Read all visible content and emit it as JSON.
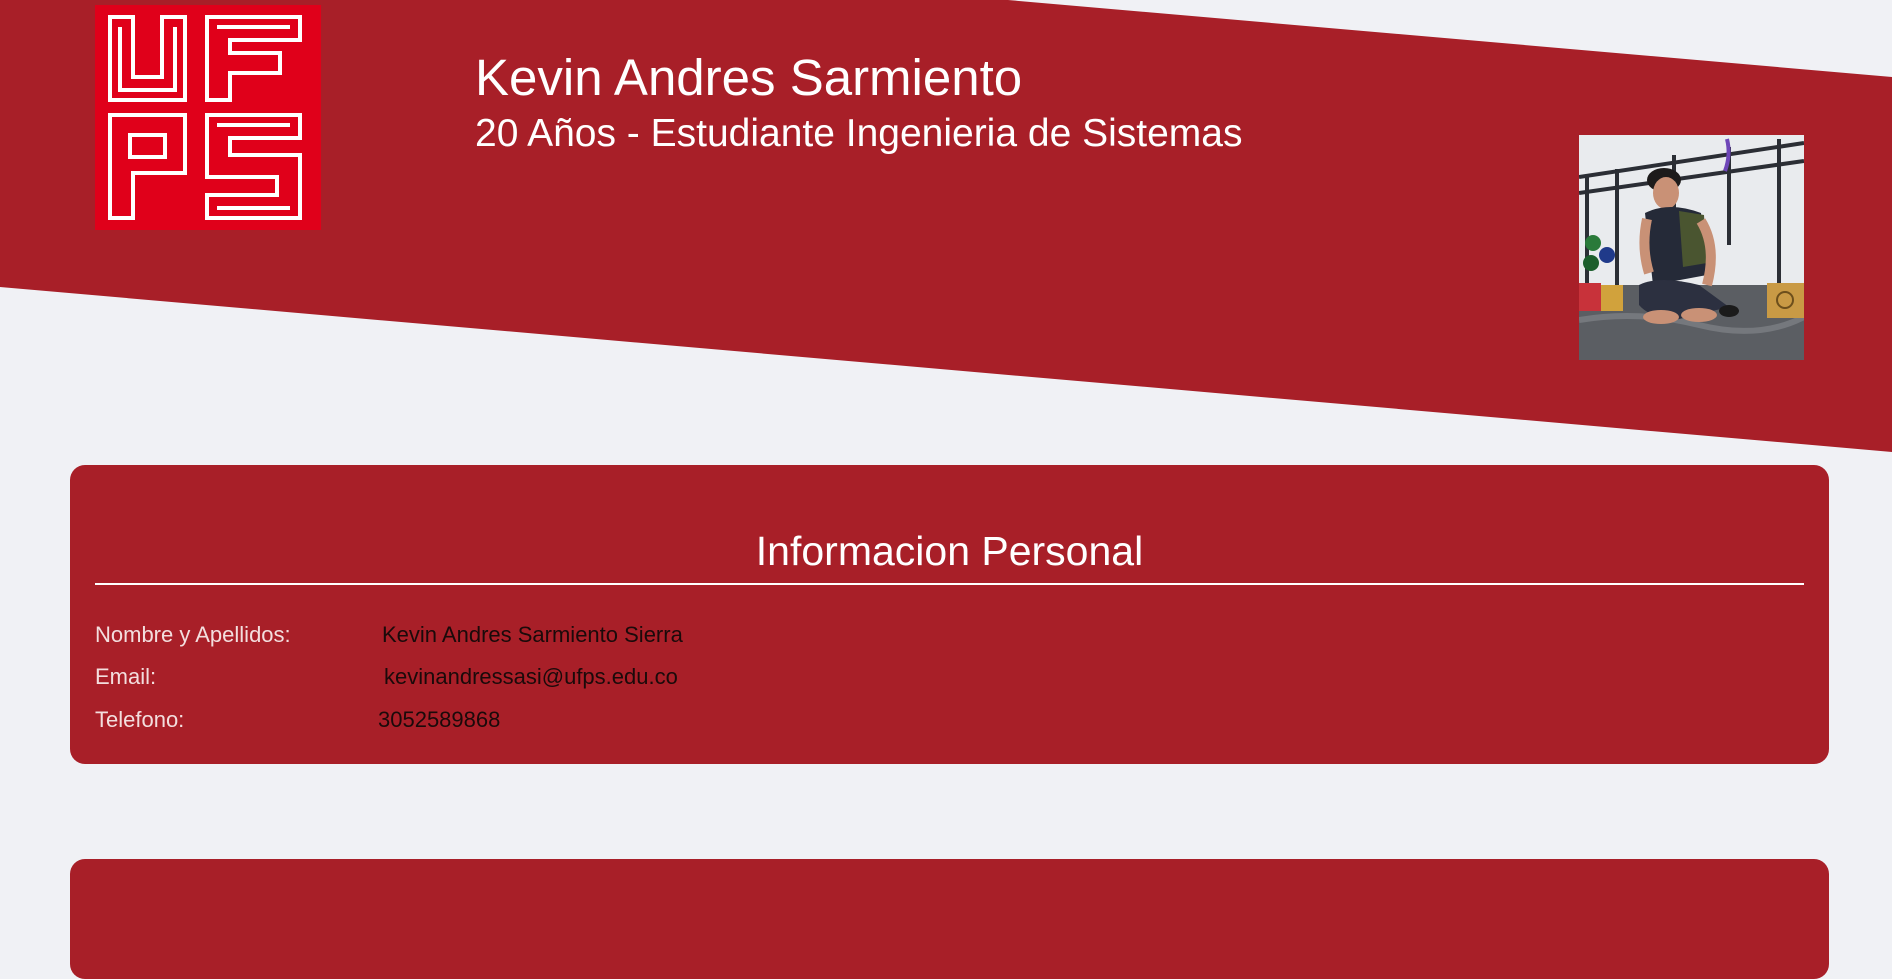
{
  "header": {
    "name": "Kevin Andres Sarmiento",
    "subtitle": "20 Años - Estudiante Ingenieria de Sistemas",
    "logo_text": "UFPS",
    "logo_color": "#e0001a",
    "banner_color": "#a81f28",
    "photo_alt": "Foto de perfil"
  },
  "personal_info": {
    "title": "Informacion Personal",
    "rows": [
      {
        "label": "Nombre y Apellidos:",
        "value": "Kevin Andres Sarmiento Sierra"
      },
      {
        "label": "Email:",
        "value": "kevinandressasi@ufps.edu.co"
      },
      {
        "label": "Telefono:",
        "value": "3052589868"
      }
    ]
  },
  "colors": {
    "page_background": "#f0f1f5",
    "card_background": "#a81f28",
    "title_text": "#ffffff",
    "label_text": "#f3dede",
    "value_text": "#1a0a0a"
  }
}
